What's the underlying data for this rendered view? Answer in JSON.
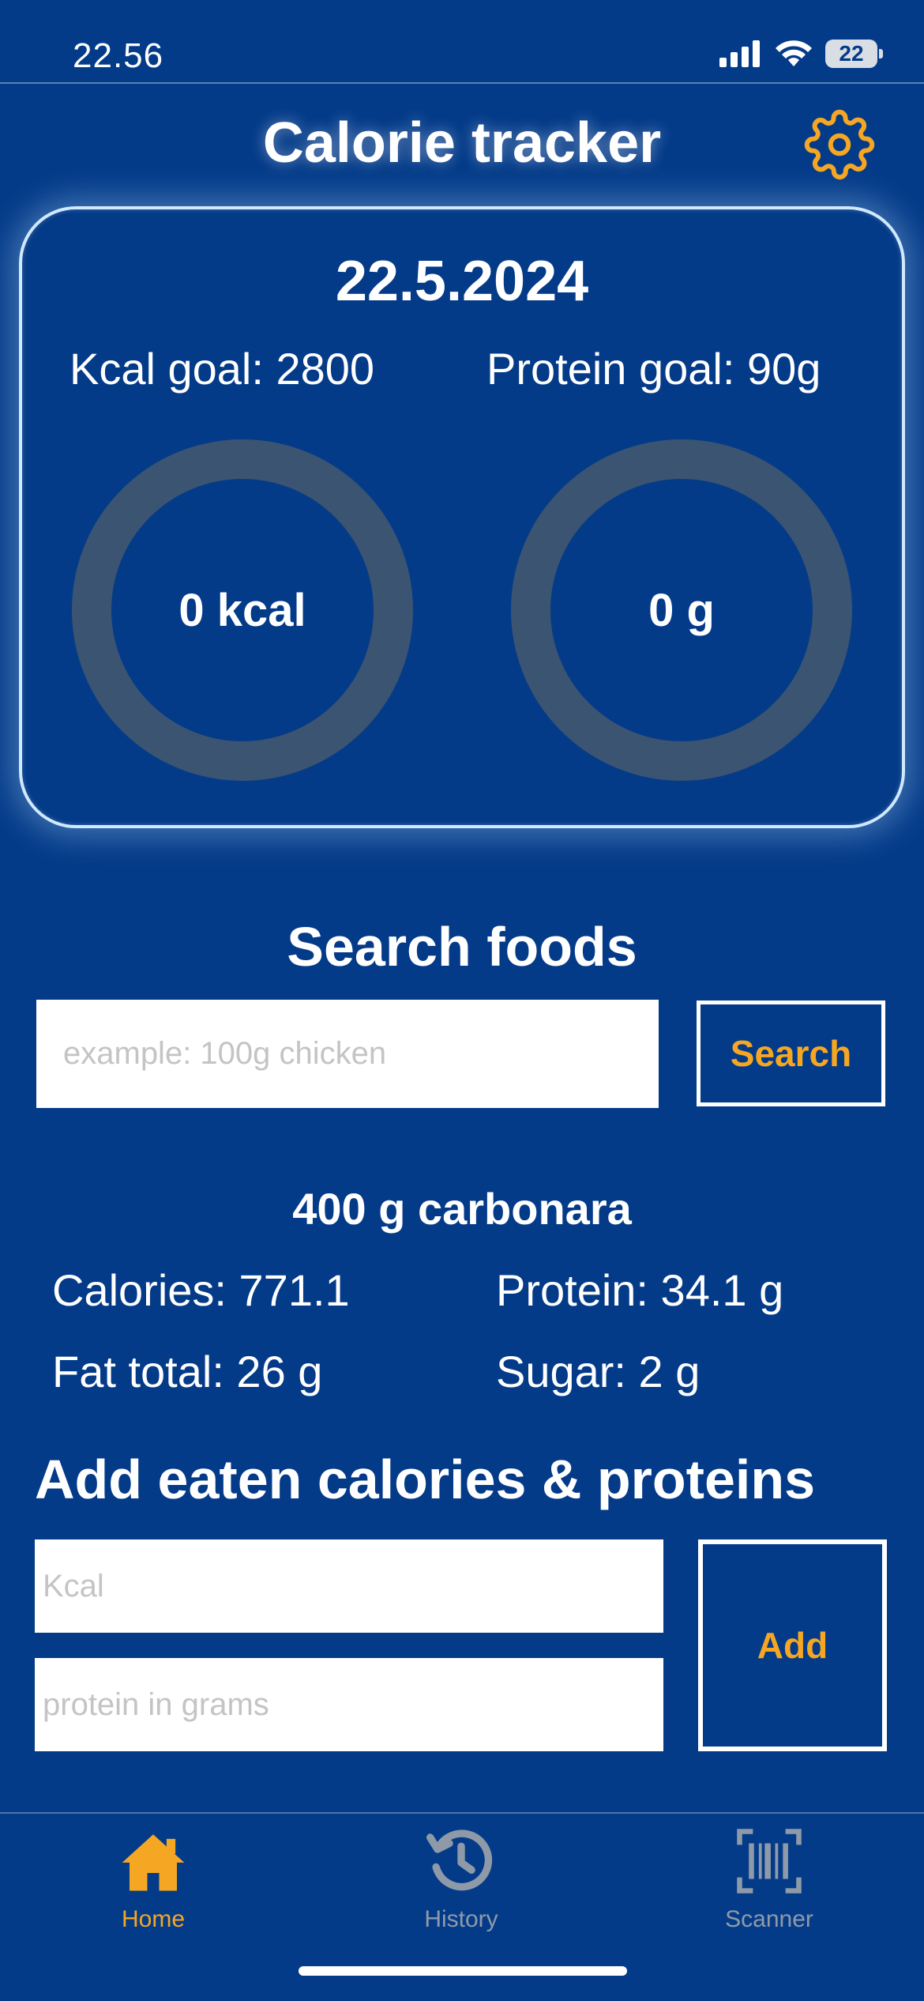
{
  "status_bar": {
    "time": "22.56",
    "battery": "22"
  },
  "header": {
    "title": "Calorie tracker",
    "settings_icon": "gear-icon"
  },
  "summary": {
    "date": "22.5.2024",
    "kcal_goal": "Kcal goal: 2800",
    "protein_goal": "Protein goal: 90g",
    "kcal_value": "0 kcal",
    "protein_value": "0 g",
    "kcal_progress": 0,
    "protein_progress": 0
  },
  "search": {
    "title": "Search foods",
    "placeholder": "example: 100g chicken",
    "button": "Search"
  },
  "result": {
    "title": "400 g carbonara",
    "calories": "Calories: 771.1",
    "protein": "Protein: 34.1 g",
    "fat": "Fat total: 26 g",
    "sugar": "Sugar: 2 g"
  },
  "add": {
    "title": "Add eaten calories & proteins",
    "kcal_placeholder": "Kcal",
    "protein_placeholder": "protein in grams",
    "button": "Add"
  },
  "tabs": [
    {
      "label": "Home",
      "icon": "home-icon",
      "active": true
    },
    {
      "label": "History",
      "icon": "history-icon",
      "active": false
    },
    {
      "label": "Scanner",
      "icon": "barcode-scanner-icon",
      "active": false
    }
  ],
  "colors": {
    "background": "#043b89",
    "accent": "#f5a623",
    "ring_track": "#3b5471",
    "inactive_tab": "#8f9aa8"
  }
}
